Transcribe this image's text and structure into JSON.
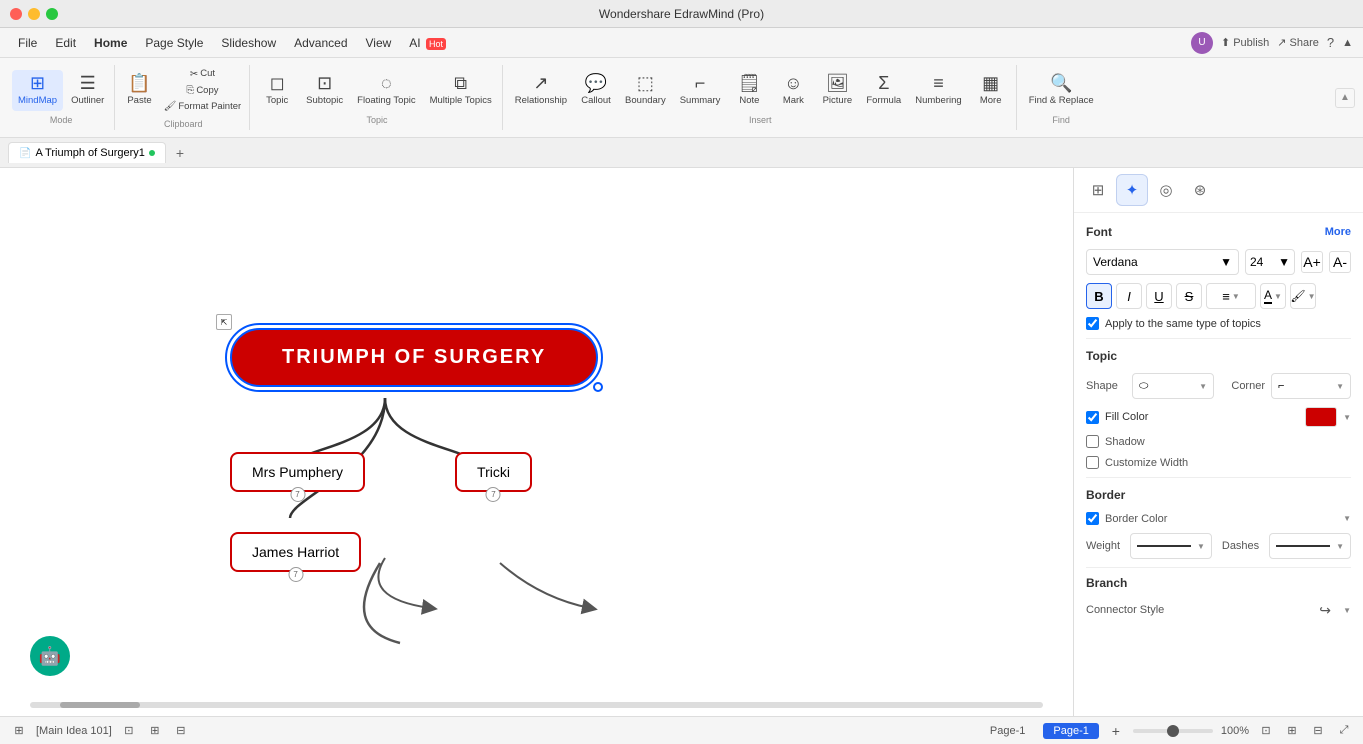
{
  "titleBar": {
    "title": "Wondershare EdrawMind (Pro)"
  },
  "menuBar": {
    "items": [
      "File",
      "Edit",
      "Home",
      "Page Style",
      "Slideshow",
      "Advanced",
      "View",
      "AI"
    ],
    "active": "Home",
    "hotItem": "AI",
    "right": {
      "publish": "Publish",
      "share": "Share"
    }
  },
  "toolbar": {
    "mode": {
      "label": "Mode",
      "items": [
        {
          "id": "mindmap",
          "icon": "⊞",
          "label": "MindMap",
          "active": true
        },
        {
          "id": "outliner",
          "icon": "☰",
          "label": "Outliner"
        }
      ]
    },
    "clipboard": {
      "label": "Clipboard",
      "items": [
        {
          "id": "paste",
          "icon": "📋",
          "label": "Paste"
        },
        {
          "id": "cut",
          "icon": "✂",
          "label": "Cut"
        },
        {
          "id": "copy",
          "icon": "⎘",
          "label": "Copy"
        },
        {
          "id": "format-painter",
          "icon": "🖌",
          "label": "Format\nPainter"
        }
      ]
    },
    "topic": {
      "label": "Topic",
      "items": [
        {
          "id": "topic",
          "icon": "◻",
          "label": "Topic"
        },
        {
          "id": "subtopic",
          "icon": "◻◻",
          "label": "Subtopic"
        },
        {
          "id": "floating-topic",
          "icon": "◌",
          "label": "Floating\nTopic"
        },
        {
          "id": "multiple-topics",
          "icon": "⧉",
          "label": "Multiple\nTopics"
        }
      ]
    },
    "insert": {
      "label": "Insert",
      "items": [
        {
          "id": "relationship",
          "icon": "↗",
          "label": "Relationship"
        },
        {
          "id": "callout",
          "icon": "💬",
          "label": "Callout"
        },
        {
          "id": "boundary",
          "icon": "⬚",
          "label": "Boundary"
        },
        {
          "id": "summary",
          "icon": "⌐",
          "label": "Summary"
        },
        {
          "id": "note",
          "icon": "🗒",
          "label": "Note"
        },
        {
          "id": "mark",
          "icon": "☺",
          "label": "Mark"
        },
        {
          "id": "picture",
          "icon": "🖼",
          "label": "Picture"
        },
        {
          "id": "formula",
          "icon": "Σ",
          "label": "Formula"
        },
        {
          "id": "numbering",
          "icon": "≡",
          "label": "Numbering"
        },
        {
          "id": "more",
          "icon": "▦",
          "label": "More"
        }
      ]
    },
    "find": {
      "items": [
        {
          "id": "find-replace",
          "icon": "🔍",
          "label": "Find &\nReplace"
        }
      ]
    }
  },
  "tabs": {
    "items": [
      {
        "id": "tab1",
        "label": "A Triumph of Surgery1",
        "active": true,
        "dot": true
      }
    ],
    "addLabel": "+"
  },
  "canvas": {
    "central": "TRIUMPH OF SURGERY",
    "children": [
      {
        "id": "mrs-pumphery",
        "label": "Mrs Pumphery",
        "badge": "7"
      },
      {
        "id": "tricki",
        "label": "Tricki",
        "badge": "7"
      },
      {
        "id": "james-harriot",
        "label": "James Harriot",
        "badge": "7"
      }
    ]
  },
  "rightPanel": {
    "tabs": [
      {
        "id": "format",
        "icon": "⊞",
        "active": false
      },
      {
        "id": "style",
        "icon": "✦",
        "active": true
      },
      {
        "id": "location",
        "icon": "◎"
      },
      {
        "id": "settings",
        "icon": "⊛"
      }
    ],
    "font": {
      "sectionLabel": "Font",
      "moreLabel": "More",
      "fontFamily": "Verdana",
      "fontSize": "24",
      "bold": true,
      "italic": false,
      "underline": false,
      "strikethrough": false,
      "align": "center",
      "fontColor": "#000000",
      "fillColor": "#cc0000",
      "applyToSame": true,
      "applyToSameLabel": "Apply to the same type of topics"
    },
    "topic": {
      "sectionLabel": "Topic",
      "shapeLabel": "Shape",
      "cornerLabel": "Corner",
      "fillColorLabel": "Fill Color",
      "fillColorEnabled": true,
      "fillColor": "#cc0000",
      "shadowLabel": "Shadow",
      "shadowEnabled": false,
      "customizeWidthLabel": "Customize Width",
      "customizeWidthEnabled": false
    },
    "border": {
      "sectionLabel": "Border",
      "colorLabel": "Border Color",
      "colorEnabled": true,
      "weightLabel": "Weight",
      "dashesLabel": "Dashes"
    },
    "branch": {
      "sectionLabel": "Branch",
      "connectorStyleLabel": "Connector Style"
    }
  },
  "statusBar": {
    "leftIcon": "sidebar",
    "pageIndicator": "[Main Idea 101]",
    "pages": [
      {
        "id": "page1",
        "label": "Page-1",
        "active": false
      },
      {
        "id": "page2",
        "label": "Page-1",
        "active": true
      }
    ],
    "addPage": "+",
    "zoom": "100%",
    "fitIcons": [
      "fit-width",
      "fit-page",
      "fit-selection"
    ],
    "fullscreen": "⤢"
  }
}
